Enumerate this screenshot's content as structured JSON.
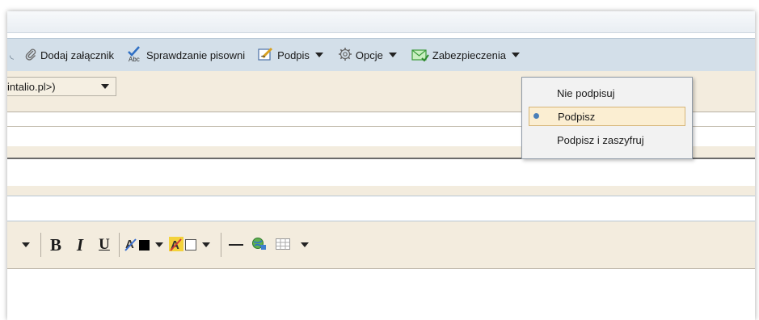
{
  "toolbar": {
    "attach_label": "Dodaj załącznik",
    "spell_label": "Sprawdzanie pisowni",
    "signature_label": "Podpis",
    "options_label": "Opcje",
    "security_label": "Zabezpieczenia"
  },
  "from": {
    "value": "intalio.pl>)"
  },
  "security_menu": {
    "items": [
      {
        "label": "Nie podpisuj",
        "selected": false
      },
      {
        "label": "Podpisz",
        "selected": true
      },
      {
        "label": "Podpisz i zaszyfruj",
        "selected": false
      }
    ]
  },
  "format_toolbar": {
    "bold": "B",
    "italic": "I",
    "underline": "U"
  },
  "colors": {
    "toolbar_bg": "#d3dfe9",
    "panel_bg": "#f3ecde",
    "menu_selected_bg": "#fbeed2",
    "radio_dot": "#4a7fb8"
  }
}
